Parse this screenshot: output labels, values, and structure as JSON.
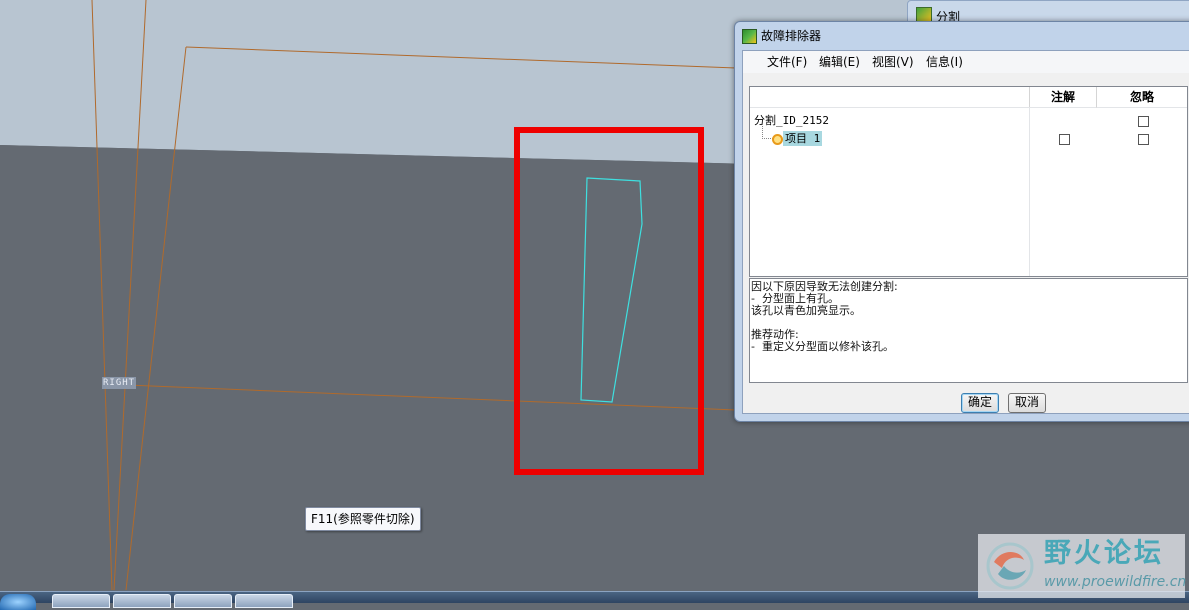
{
  "viewport": {
    "background_color": "#646a72",
    "sky_color": "#b8c5d1",
    "datum_plane_label": "RIGHT",
    "tooltip": "F11(参照零件切除)",
    "highlight_color": "#ee0000",
    "hole_outline_color": "#3ee0e0",
    "datum_line_color": "#b06a2c"
  },
  "back_window": {
    "title": "分割"
  },
  "dialog": {
    "title": "故障排除器",
    "menu": [
      "文件(F)",
      "编辑(E)",
      "视图(V)",
      "信息(I)"
    ],
    "columns": {
      "name": "",
      "note": "注解",
      "ignore": "忽略"
    },
    "tree": {
      "root": {
        "label": "分割_ID_2152",
        "ignore_checked": false
      },
      "child": {
        "label": "项目 1",
        "note_checked": false,
        "ignore_checked": false
      }
    },
    "message_lines": [
      "因以下原因导致无法创建分割:",
      "-  分型面上有孔。",
      "该孔以青色加亮显示。",
      "",
      "推荐动作:",
      "-  重定义分型面以修补该孔。"
    ],
    "ok_label": "确定",
    "cancel_label": "取消"
  },
  "watermark": {
    "title": "野火论坛",
    "url": "www.proewildfire.cn"
  }
}
